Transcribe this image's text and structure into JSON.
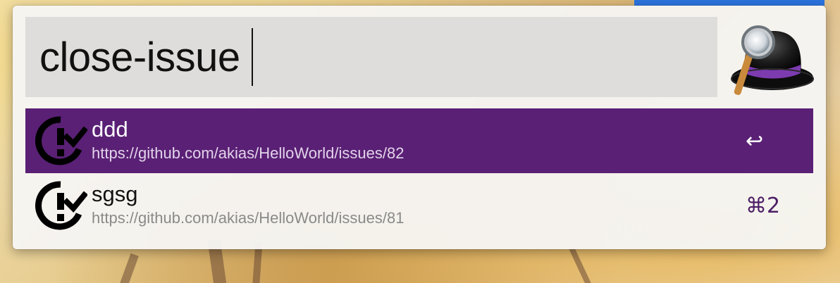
{
  "search": {
    "query": "close-issue"
  },
  "results": [
    {
      "title": "ddd",
      "subtitle": "https://github.com/akias/HelloWorld/issues/82",
      "shortcut": "↩",
      "selected": true
    },
    {
      "title": "sgsg",
      "subtitle": "https://github.com/akias/HelloWorld/issues/81",
      "shortcut": "⌘2",
      "selected": false
    }
  ],
  "icons": {
    "app": "alfred-hat-icon",
    "result": "issue-closed-icon"
  },
  "colors": {
    "selection": "#5a2075",
    "shortcut": "#4b1d66",
    "hat_band": "#7d3bb0"
  }
}
